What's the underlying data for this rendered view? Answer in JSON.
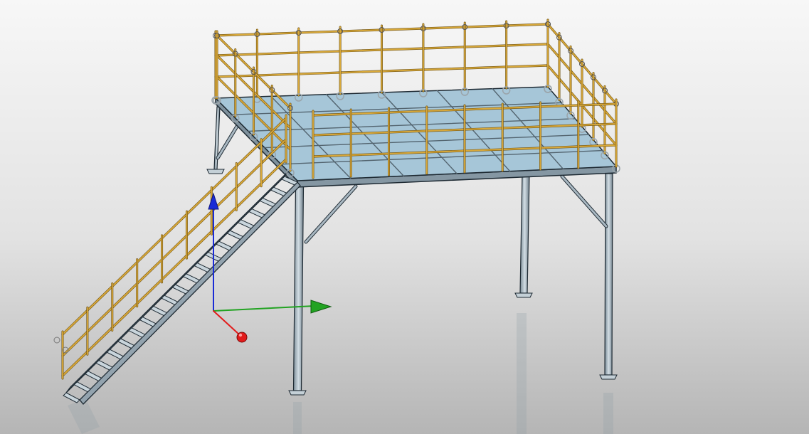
{
  "viewport": {
    "background_top": "#f7f7f7",
    "background_bottom": "#b5b5b5"
  },
  "model": {
    "deck_color": "#a6c6d8",
    "steel_color": "#a9b8c2",
    "steel_edge_color": "#1e2a33",
    "railing_color": "#d9a93a"
  },
  "triad": {
    "x_axis_color": "#e21b1b",
    "y_axis_color": "#22a322",
    "z_axis_color": "#1a2bd6",
    "x_handle_icon": "sphere-handle-icon",
    "y_handle_icon": "cone-arrow-icon",
    "z_handle_icon": "cone-arrow-icon"
  }
}
